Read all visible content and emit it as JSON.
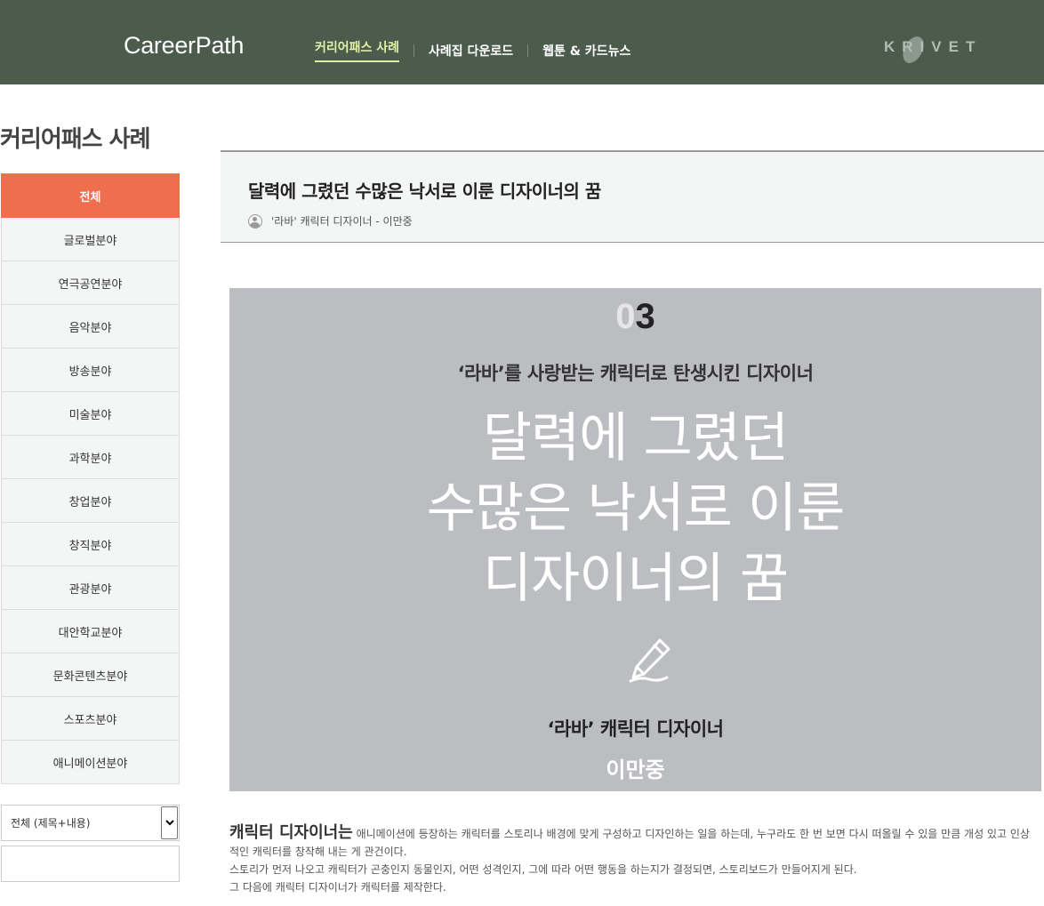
{
  "header": {
    "logo": "CareerPath",
    "nav": [
      "커리어패스 사례",
      "사례집 다운로드",
      "웹툰 & 카드뉴스"
    ],
    "brand": "KRIVET"
  },
  "page_title": "커리어패스 사례",
  "sidebar": {
    "categories": [
      "전체",
      "글로벌분야",
      "연극공연분야",
      "음악분야",
      "방송분야",
      "미술분야",
      "과학분야",
      "창업분야",
      "창직분야",
      "관광분야",
      "대안학교분야",
      "문화콘텐츠분야",
      "스포츠분야",
      "애니메이션분야"
    ],
    "search_select": "전체 (제목+내용)",
    "search_value": ""
  },
  "article": {
    "title": "달력에 그렸던 수많은 낙서로 이룬 디자이너의 꿈",
    "meta": "'라바' 캐릭터 디자이너 - 이만중"
  },
  "hero": {
    "num_dim": "0",
    "num_main": "3",
    "subtitle": "‘라바’를 사랑받는 캐릭터로 탄생시킨 디자이너",
    "line1": "달력에 그렸던",
    "line2": "수많은 낙서로 이룬",
    "line3": "디자이너의 꿈",
    "role": "‘라바’ 캐릭터 디자이너",
    "name": "이만중"
  },
  "body": {
    "lead": "캐릭터 디자이너는",
    "p1": " 애니메이션에 등장하는 캐릭터를 스토리나 배경에 맞게 구성하고 디자인하는 일을 하는데, 누구라도 한 번 보면 다시 떠올릴 수 있을 만큼 개성 있고 인상적인 캐릭터를 창작해 내는 게 관건이다.",
    "p2": "스토리가 먼저 나오고 캐릭터가 곤충인지 동물인지, 어떤 성격인지, 그에 따라 어떤 행동을 하는지가 결정되면, 스토리보드가 만들어지게 된다.",
    "p3": "그 다음에 캐릭터 디자이너가 캐릭터를 제작한다."
  },
  "colors": {
    "header_bg": "#4b5c4d",
    "nav_active": "#e2f0a8",
    "category_active": "#ef6e4e",
    "hero_bg": "#bcbdc1"
  },
  "icons": [
    "user-icon",
    "pencil-icon",
    "dropdown-arrow-icon"
  ]
}
